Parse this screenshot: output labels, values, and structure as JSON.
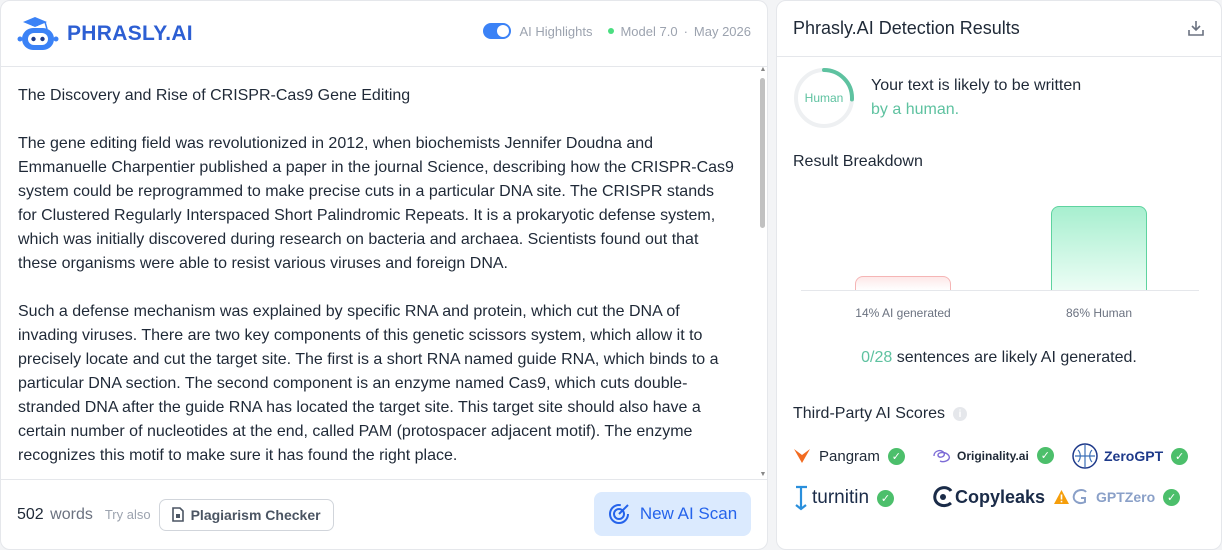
{
  "app": {
    "brand": "PHRASLY.AI"
  },
  "header": {
    "toggle_label": "AI Highlights",
    "model": "Model 7.0",
    "sep": "·",
    "date": "May 2026"
  },
  "document": {
    "title": "The Discovery and Rise of CRISPR-Cas9 Gene Editing",
    "paragraphs": [
      "The gene editing field was revolutionized in 2012, when biochemists Jennifer Doudna and Emmanuelle Charpentier published a paper in the journal Science, describing how the CRISPR-Cas9 system could be reprogrammed to make precise cuts in a particular DNA site. The CRISPR stands for Clustered Regularly Interspaced Short Palindromic Repeats. It is a prokaryotic defense system, which was initially discovered during research on bacteria and archaea. Scientists found out that these organisms were able to resist various viruses and foreign DNA.",
      "Such a defense mechanism was explained by specific RNA and protein, which cut the DNA of invading viruses. There are two key components of this genetic scissors system, which allow it to precisely locate and cut the target site. The first is a short RNA named guide RNA, which binds to a particular DNA section. The second component is an enzyme named Cas9, which cuts double-stranded DNA after the guide RNA has located the target site. This target site should also have a certain number of nucleotides at the end, called PAM (protospacer adjacent motif). The enzyme recognizes this motif to make sure it has found the right place."
    ]
  },
  "footer": {
    "word_count": "502",
    "word_unit": "words",
    "try_also": "Try also",
    "plagiarism_label": "Plagiarism Checker",
    "scan_label": "New AI Scan"
  },
  "results": {
    "title": "Phrasly.AI Detection Results",
    "gauge_label": "Human",
    "verdict_line1": "Your text is likely to be written",
    "verdict_line2": "by a human.",
    "breakdown_title": "Result Breakdown",
    "sentences_count": "0/28",
    "sentences_mid": "sentences are likely",
    "sentences_end": "AI generated",
    "sentences_period": ".",
    "third_party_title": "Third-Party AI Scores",
    "info_glyph": "i"
  },
  "chart_data": {
    "type": "bar",
    "categories": [
      "14% AI generated",
      "86% Human"
    ],
    "values": [
      14,
      86
    ],
    "ylim": [
      0,
      100
    ],
    "colors": [
      "#f5b5b5",
      "#5ed39f"
    ]
  },
  "third_party": [
    {
      "name": "Pangram",
      "status": "pass",
      "icon": "pangram-logo"
    },
    {
      "name": "Originality.ai",
      "status": "pass",
      "icon": "originality-logo"
    },
    {
      "name": "ZeroGPT",
      "status": "pass",
      "icon": "zerogpt-logo"
    },
    {
      "name": "turnitin",
      "status": "pass",
      "icon": "turnitin-logo"
    },
    {
      "name": "Copyleaks",
      "status": "warning",
      "icon": "copyleaks-logo"
    },
    {
      "name": "GPTZero",
      "status": "pass",
      "icon": "gptzero-logo"
    }
  ],
  "colors": {
    "accent": "#2563eb",
    "brand": "#2d5fd3",
    "human_green": "#5ec2a0",
    "ai_red": "#f5b5b5",
    "check_green": "#4cbf6b",
    "warning": "#f59e0b"
  }
}
